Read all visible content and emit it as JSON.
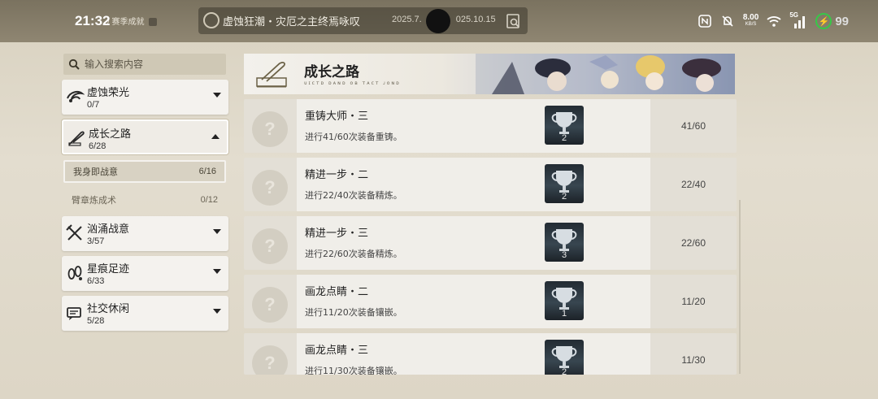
{
  "status_bar": {
    "time": "21:32",
    "net_speed_value": "8.00",
    "net_speed_unit": "KB/S",
    "signal_label": "5G",
    "battery_level": "99"
  },
  "breadcrumb": {
    "path": "/  赛季成就"
  },
  "event": {
    "title": "虚蚀狂潮・灾厄之主终焉咏叹",
    "date_start": "2025.7.",
    "date_end": "025.10.15"
  },
  "search": {
    "placeholder": "输入搜索内容"
  },
  "categories": [
    {
      "name": "虚蚀荣光",
      "count": "0/7",
      "icon": "swirl-icon"
    },
    {
      "name": "成长之路",
      "count": "6/28",
      "icon": "quill-icon"
    },
    {
      "name": "汹涌战意",
      "count": "3/57",
      "icon": "crossed-swords-icon"
    },
    {
      "name": "星痕足迹",
      "count": "6/33",
      "icon": "footprint-icon"
    },
    {
      "name": "社交休闲",
      "count": "5/28",
      "icon": "chat-icon"
    }
  ],
  "subcategories": [
    {
      "name": "我身即战意",
      "count": "6/16"
    },
    {
      "name": "臂章炼成术",
      "count": "0/12"
    }
  ],
  "section": {
    "title": "成长之路",
    "subtitle": "ᴜɪᴄᴛᴅ ᴅᴀɴᴅ ᴏʙ ᴛᴀᴄᴛ ᴊᴏɴᴅ"
  },
  "achievements": [
    {
      "title": "重铸大师・三",
      "desc": "进行41/60次装备重铸。",
      "level": "2",
      "progress": "41/60"
    },
    {
      "title": "精进一步・二",
      "desc": "进行22/40次装备精炼。",
      "level": "2",
      "progress": "22/40"
    },
    {
      "title": "精进一步・三",
      "desc": "进行22/60次装备精炼。",
      "level": "3",
      "progress": "22/60"
    },
    {
      "title": "画龙点睛・二",
      "desc": "进行11/20次装备镶嵌。",
      "level": "1",
      "progress": "11/20"
    },
    {
      "title": "画龙点睛・三",
      "desc": "进行11/30次装备镶嵌。",
      "level": "2",
      "progress": "11/30"
    }
  ],
  "locked_badge_glyph": "?",
  "colors": {
    "accent_green": "#37c848",
    "panel_bg": "#f0eee9",
    "topbar": "#7a725f"
  }
}
